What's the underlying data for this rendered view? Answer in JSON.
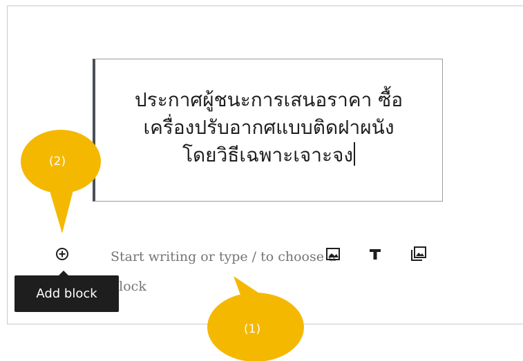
{
  "heading": {
    "lines": [
      "ประกาศผู้ชนะการเสนอราคา ซื้อ",
      "เครื่องปรับอากศแบบติดฝาผนัง",
      "โดยวิธีเฉพาะเจาะจง"
    ]
  },
  "empty_paragraph": {
    "placeholder": "Start writing or type / to choose a block"
  },
  "inserter": {
    "icon": "plus-circle-icon",
    "tooltip": "Add block"
  },
  "quick_inserter": {
    "icons": [
      "image-icon",
      "heading-icon",
      "gallery-icon"
    ]
  },
  "annotations": [
    {
      "label": "(1)",
      "color": "#f5b800"
    },
    {
      "label": "(2)",
      "color": "#f5b800"
    }
  ]
}
